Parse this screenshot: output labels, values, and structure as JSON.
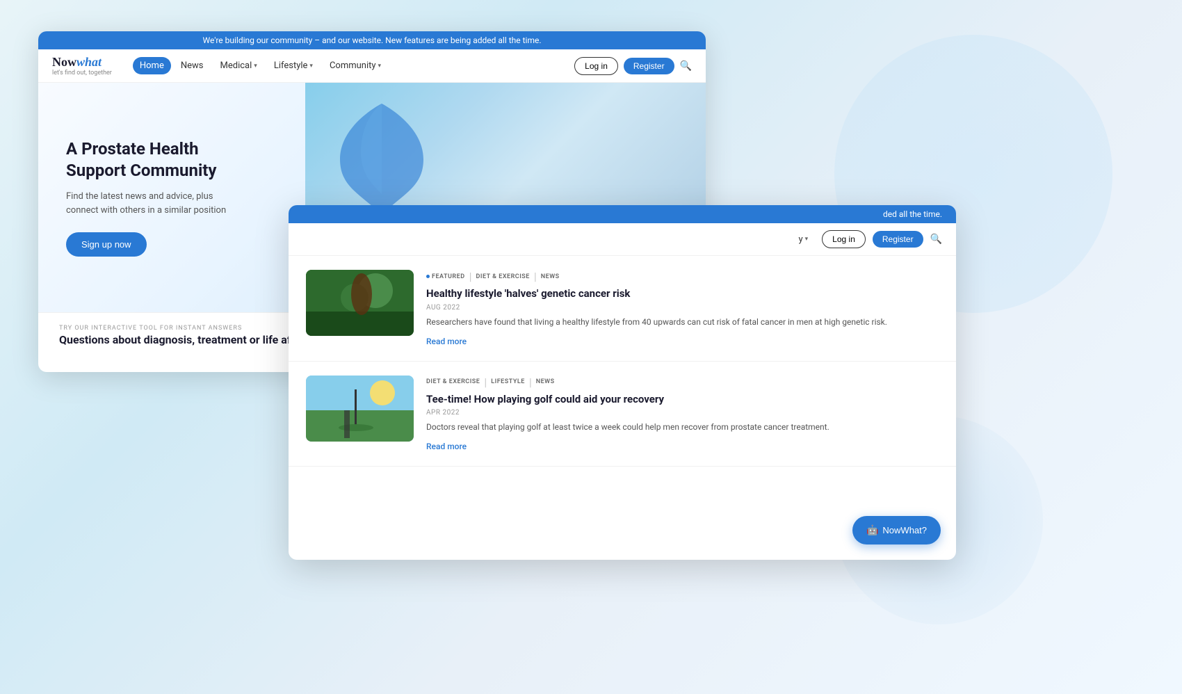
{
  "background": {
    "gradient": "linear-gradient(135deg, #e8f4f8, #d0eaf5, #e8f0f8, #f0f8ff)"
  },
  "main_window": {
    "announcement": "We're building our community – and our website. New features are being added all the time.",
    "logo": {
      "now": "Now",
      "what": "what",
      "tagline": "let's find out, together"
    },
    "nav": {
      "items": [
        {
          "label": "Home",
          "active": true,
          "has_dropdown": false
        },
        {
          "label": "News",
          "active": false,
          "has_dropdown": false
        },
        {
          "label": "Medical",
          "active": false,
          "has_dropdown": true
        },
        {
          "label": "Lifestyle",
          "active": false,
          "has_dropdown": true
        },
        {
          "label": "Community",
          "active": false,
          "has_dropdown": true
        }
      ],
      "login": "Log in",
      "register": "Register"
    },
    "hero": {
      "title": "A Prostate Health Support Community",
      "subtitle": "Find the latest news and advice, plus connect with others in a similar position",
      "cta": "Sign up now"
    },
    "tool_section": {
      "label": "TRY OUR INTERACTIVE TOOL FOR INSTANT ANSWERS",
      "question": "Questions about diagnosis, treatment or life after cancer?",
      "button": "NowWhat?"
    }
  },
  "second_window": {
    "announcement_partial": "ded all the time.",
    "nav": {
      "partial_item": "y",
      "login": "Log in",
      "register": "Register"
    },
    "articles": [
      {
        "tags": [
          "FEATURED",
          "DIET & EXERCISE",
          "NEWS"
        ],
        "title": "Healthy lifestyle 'halves' genetic cancer risk",
        "date": "AUG 2022",
        "excerpt": "Researchers have found that living a healthy lifestyle from 40 upwards can cut risk of fatal cancer in men at high genetic risk.",
        "read_more": "Read more",
        "image_alt": "man and child outdoors in garden"
      },
      {
        "tags": [
          "DIET & EXERCISE",
          "LIFESTYLE",
          "NEWS"
        ],
        "title": "Tee-time! How playing golf could aid your recovery",
        "date": "APR 2022",
        "excerpt": "Doctors reveal that playing golf at least twice a week could help men recover from prostate cancer treatment.",
        "read_more": "Read more",
        "image_alt": "golfer on course"
      }
    ],
    "nowwhat_button": "NowWhat?"
  }
}
